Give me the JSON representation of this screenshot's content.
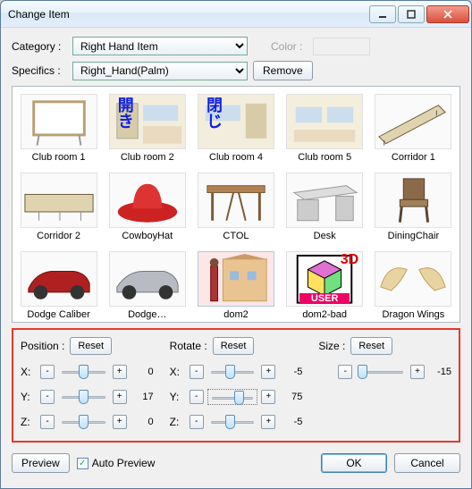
{
  "window": {
    "title": "Change Item"
  },
  "form": {
    "category_label": "Category :",
    "category_value": "Right Hand Item",
    "specifics_label": "Specifics :",
    "specifics_value": "Right_Hand(Palm)",
    "remove_label": "Remove",
    "color_label": "Color :"
  },
  "gallery": {
    "items": [
      {
        "label": "Club room 1",
        "overlay": ""
      },
      {
        "label": "Club room 2",
        "overlay": "開き"
      },
      {
        "label": "Club room 4",
        "overlay": "閉じ"
      },
      {
        "label": "Club room 5",
        "overlay": ""
      },
      {
        "label": "Corridor 1",
        "overlay": ""
      },
      {
        "label": "Corridor 2",
        "overlay": ""
      },
      {
        "label": "CowboyHat",
        "overlay": ""
      },
      {
        "label": "CTOL",
        "overlay": ""
      },
      {
        "label": "Desk",
        "overlay": ""
      },
      {
        "label": "DiningChair",
        "overlay": ""
      },
      {
        "label": "Dodge Caliber",
        "overlay": ""
      },
      {
        "label": "Dodge…",
        "overlay": ""
      },
      {
        "label": "dom2",
        "overlay": "",
        "selected": true
      },
      {
        "label": "dom2-bad",
        "overlay": "3D USER"
      },
      {
        "label": "Dragon Wings",
        "overlay": ""
      }
    ]
  },
  "controls": {
    "position": {
      "label": "Position :",
      "reset": "Reset",
      "axes": [
        {
          "name": "X:",
          "value": 0,
          "pos": 50
        },
        {
          "name": "Y:",
          "value": 17,
          "pos": 50
        },
        {
          "name": "Z:",
          "value": 0,
          "pos": 50
        }
      ]
    },
    "rotate": {
      "label": "Rotate :",
      "reset": "Reset",
      "axes": [
        {
          "name": "X:",
          "value": -5,
          "pos": 45
        },
        {
          "name": "Y:",
          "value": 75,
          "pos": 62,
          "active": true
        },
        {
          "name": "Z:",
          "value": -5,
          "pos": 45
        }
      ]
    },
    "size": {
      "label": "Size :",
      "reset": "Reset",
      "axes": [
        {
          "name": "",
          "value": -15,
          "pos": 12
        }
      ]
    }
  },
  "footer": {
    "preview": "Preview",
    "auto_preview": "Auto Preview",
    "ok": "OK",
    "cancel": "Cancel"
  }
}
